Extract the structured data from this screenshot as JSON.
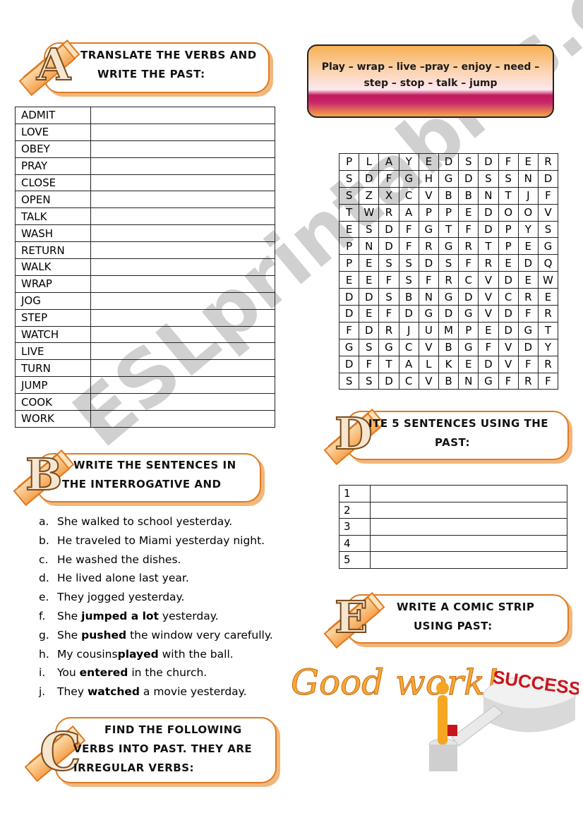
{
  "sections": {
    "a": {
      "letter": "A",
      "title_line1": "TRANSLATE THE VERBS AND",
      "title_line2": "WRITE THE PAST:",
      "verbs": [
        "ADMIT",
        "LOVE",
        "OBEY",
        "PRAY",
        "CLOSE",
        "OPEN",
        "TALK",
        "WASH",
        "RETURN",
        "WALK",
        "WRAP",
        "JOG",
        "STEP",
        "WATCH",
        "LIVE",
        "TURN",
        "JUMP",
        "COOK",
        "WORK"
      ]
    },
    "word_box": {
      "line1": "Play – wrap – live –pray – enjoy – need –",
      "line2": "step – stop – talk – jump"
    },
    "word_search": [
      [
        "P",
        "L",
        "A",
        "Y",
        "E",
        "D",
        "S",
        "D",
        "F",
        "E",
        "R"
      ],
      [
        "S",
        "D",
        "F",
        "G",
        "H",
        "G",
        "D",
        "S",
        "S",
        "N",
        "D"
      ],
      [
        "S",
        "Z",
        "X",
        "C",
        "V",
        "B",
        "B",
        "N",
        "T",
        "J",
        "F"
      ],
      [
        "T",
        "W",
        "R",
        "A",
        "P",
        "P",
        "E",
        "D",
        "O",
        "O",
        "V"
      ],
      [
        "E",
        "S",
        "D",
        "F",
        "G",
        "T",
        "F",
        "D",
        "P",
        "Y",
        "S"
      ],
      [
        "P",
        "N",
        "D",
        "F",
        "R",
        "G",
        "R",
        "T",
        "P",
        "E",
        "G"
      ],
      [
        "P",
        "E",
        "S",
        "S",
        "D",
        "S",
        "F",
        "R",
        "E",
        "D",
        "Q"
      ],
      [
        "E",
        "E",
        "F",
        "S",
        "F",
        "R",
        "C",
        "V",
        "D",
        "E",
        "W"
      ],
      [
        "D",
        "D",
        "S",
        "B",
        "N",
        "G",
        "D",
        "V",
        "C",
        "R",
        "E"
      ],
      [
        "D",
        "E",
        "F",
        "D",
        "G",
        "D",
        "G",
        "V",
        "D",
        "F",
        "R"
      ],
      [
        "F",
        "D",
        "R",
        "J",
        "U",
        "M",
        "P",
        "E",
        "D",
        "G",
        "T"
      ],
      [
        "G",
        "S",
        "G",
        "C",
        "V",
        "B",
        "G",
        "F",
        "V",
        "D",
        "Y"
      ],
      [
        "D",
        "F",
        "T",
        "A",
        "L",
        "K",
        "E",
        "D",
        "V",
        "F",
        "R"
      ],
      [
        "S",
        "S",
        "D",
        "C",
        "V",
        "B",
        "N",
        "G",
        "F",
        "R",
        "F"
      ]
    ],
    "b": {
      "letter": "B",
      "title_line1": "WRITE THE SENTENCES IN",
      "title_line2": "THE INTERROGATIVE AND",
      "sentences": [
        {
          "label": "a.",
          "pre": "She walked to school yesterday.",
          "bold": "",
          "post": ""
        },
        {
          "label": "b.",
          "pre": "He traveled to Miami yesterday night.",
          "bold": "",
          "post": ""
        },
        {
          "label": "c.",
          "pre": "He washed the dishes.",
          "bold": "",
          "post": ""
        },
        {
          "label": "d.",
          "pre": "He lived alone last year.",
          "bold": "",
          "post": ""
        },
        {
          "label": "e.",
          "pre": "They jogged yesterday.",
          "bold": "",
          "post": ""
        },
        {
          "label": "f.",
          "pre": "She ",
          "bold": "jumped a lot",
          "post": " yesterday."
        },
        {
          "label": "g.",
          "pre": "She ",
          "bold": "pushed",
          "post": " the window very carefully."
        },
        {
          "label": "h.",
          "pre": "My cousins",
          "bold": "played",
          "post": " with the ball."
        },
        {
          "label": "i.",
          "pre": "You ",
          "bold": "entered",
          "post": " in the church."
        },
        {
          "label": "j.",
          "pre": "They ",
          "bold": "watched",
          "post": " a movie yesterday."
        }
      ]
    },
    "c": {
      "letter": "C",
      "title_line1": "FIND THE FOLLOWING",
      "title_line2": "VERBS INTO PAST. THEY ARE",
      "title_line3": "IRREGULAR VERBS:"
    },
    "d": {
      "letter": "D",
      "title_line1": "ITE 5 SENTENCES USING THE",
      "title_line2": "PAST:",
      "rows": [
        "1",
        "2",
        "3",
        "4",
        "5"
      ]
    },
    "e": {
      "letter": "E",
      "title_line1": "WRITE A COMIC STRIP",
      "title_line2": "USING PAST:"
    }
  },
  "decor": {
    "good_work": "Good work!",
    "success": "SUCCESS",
    "watermark": "ESLprintables.com"
  },
  "colors": {
    "banner_border": "#e07a1f",
    "accent_orange": "#f6a935",
    "success_red": "#c8161d"
  }
}
